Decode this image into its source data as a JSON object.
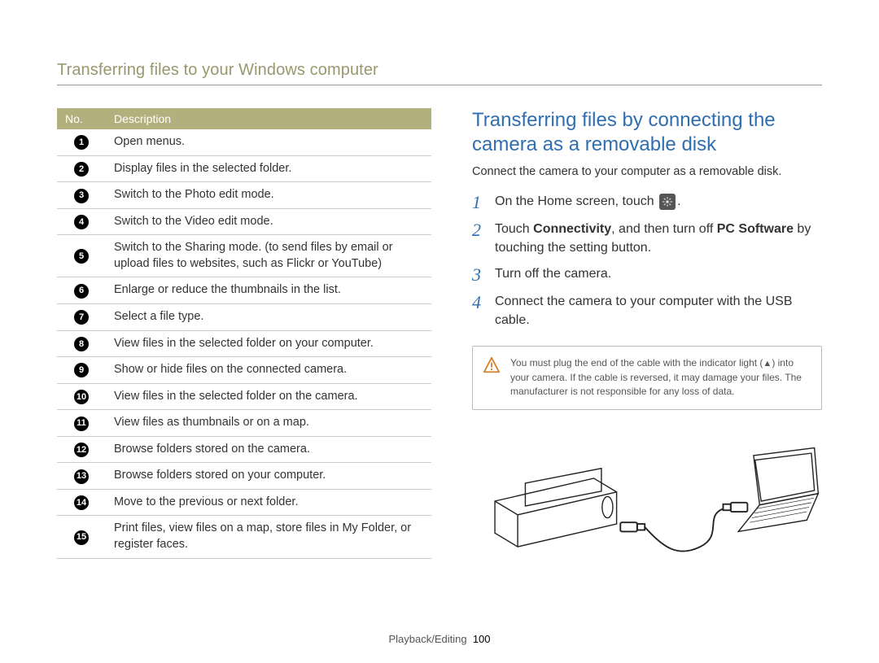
{
  "page_title": "Transferring files to your Windows computer",
  "table": {
    "header_no": "No.",
    "header_desc": "Description",
    "rows": [
      {
        "n": "1",
        "text": "Open menus."
      },
      {
        "n": "2",
        "text": "Display files in the selected folder."
      },
      {
        "n": "3",
        "text": "Switch to the Photo edit mode."
      },
      {
        "n": "4",
        "text": "Switch to the Video edit mode."
      },
      {
        "n": "5",
        "text": "Switch to the Sharing mode. (to send files by email or upload files to websites, such as Flickr or YouTube)"
      },
      {
        "n": "6",
        "text": "Enlarge or reduce the thumbnails in the list."
      },
      {
        "n": "7",
        "text": "Select a file type."
      },
      {
        "n": "8",
        "text": "View files in the selected folder on your computer."
      },
      {
        "n": "9",
        "text": "Show or hide files on the connected camera."
      },
      {
        "n": "10",
        "text": "View files in the selected folder on the camera."
      },
      {
        "n": "11",
        "text": "View files as thumbnails or on a map."
      },
      {
        "n": "12",
        "text": "Browse folders stored on the camera."
      },
      {
        "n": "13",
        "text": "Browse folders stored on your computer."
      },
      {
        "n": "14",
        "text": "Move to the previous or next folder."
      },
      {
        "n": "15",
        "text": "Print files, view files on a map, store files in My Folder, or register faces."
      }
    ]
  },
  "section_heading": "Transferring files by connecting the camera as a removable disk",
  "intro": "Connect the camera to your computer as a removable disk.",
  "steps": {
    "s1_a": "On the Home screen, touch ",
    "s1_b": ".",
    "s2_a": "Touch ",
    "s2_b": "Connectivity",
    "s2_c": ", and then turn off ",
    "s2_d": "PC Software",
    "s2_e": " by touching the setting button.",
    "s3": "Turn off the camera.",
    "s4": "Connect the camera to your computer with the USB cable."
  },
  "warning": {
    "a": "You must plug the end of the cable with the indicator light (",
    "b": ") into your camera. If the cable is reversed, it may damage your files. The manufacturer is not responsible for any loss of data."
  },
  "footer": {
    "section": "Playback/Editing",
    "page": "100"
  }
}
